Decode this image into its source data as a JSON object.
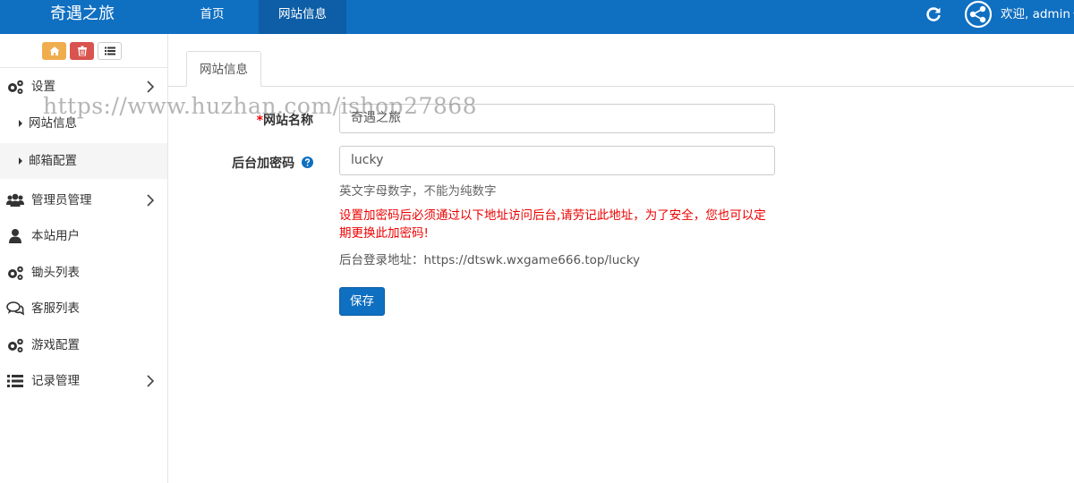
{
  "header": {
    "brand": "奇遇之旅",
    "nav": [
      {
        "label": "首页",
        "active": false
      },
      {
        "label": "网站信息",
        "active": true
      }
    ],
    "welcome": "欢迎, admin",
    "colors": {
      "bar": "#0f6fc1",
      "active_tab": "#0d5ea7"
    }
  },
  "quickbar": {
    "buttons": [
      {
        "icon": "home-icon",
        "color": "#f0ad4e"
      },
      {
        "icon": "trash-icon",
        "color": "#d9534f"
      },
      {
        "icon": "list-icon",
        "color": "#ffffff"
      }
    ]
  },
  "sidebar": {
    "items": [
      {
        "label": "设置",
        "icon": "gears-icon",
        "has_children": true
      },
      {
        "label": "网站信息",
        "sub": true
      },
      {
        "label": "邮箱配置",
        "sub": true,
        "active": true
      },
      {
        "label": "管理员管理",
        "icon": "users-icon",
        "has_children": true
      },
      {
        "label": "本站用户",
        "icon": "user-icon",
        "has_children": false
      },
      {
        "label": "锄头列表",
        "icon": "gears-icon",
        "has_children": false
      },
      {
        "label": "客服列表",
        "icon": "comments-icon",
        "has_children": false
      },
      {
        "label": "游戏配置",
        "icon": "gears-icon",
        "has_children": false
      },
      {
        "label": "记录管理",
        "icon": "list-icon",
        "has_children": true
      }
    ]
  },
  "main": {
    "tab": "网站信息",
    "form": {
      "site_name": {
        "required_mark": "*",
        "label": "网站名称",
        "value": "奇遇之旅"
      },
      "admin_key": {
        "label": "后台加密码",
        "value": "lucky",
        "help": "英文字母数字，不能为纯数字"
      },
      "warning": "设置加密码后必须通过以下地址访问后台,请劳记此地址，为了安全，您也可以定期更换此加密码!",
      "login_url": "后台登录地址：https://dtswk.wxgame666.top/lucky",
      "save_label": "保存"
    }
  },
  "watermark": "https://www.huzhan.com/ishop27868"
}
